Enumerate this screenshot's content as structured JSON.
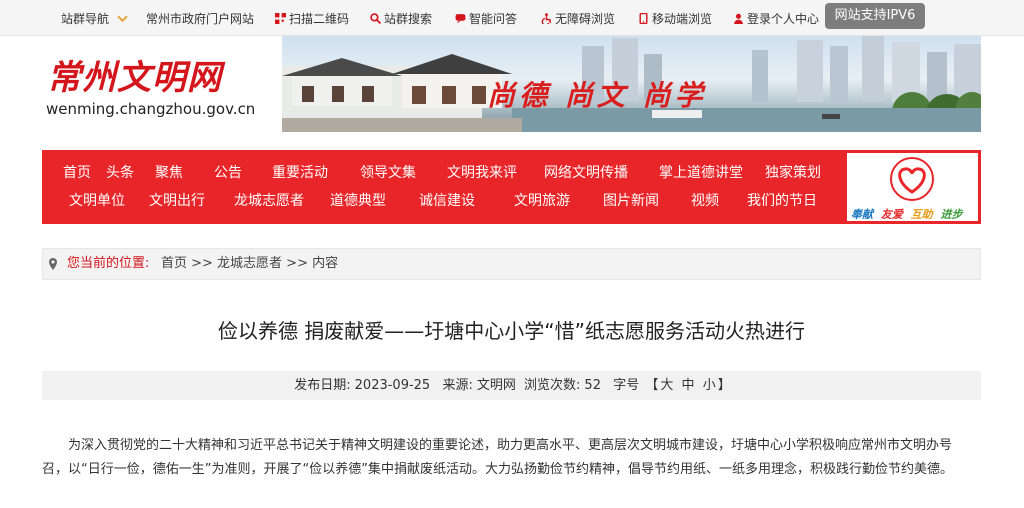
{
  "topbar": {
    "items": [
      {
        "label": "站群导航",
        "icon": "chevron-down-icon"
      },
      {
        "label": "常州市政府门户网站",
        "icon": ""
      },
      {
        "label": "扫描二维码",
        "icon": "qrcode-icon"
      },
      {
        "label": "站群搜索",
        "icon": "search-icon"
      },
      {
        "label": "智能问答",
        "icon": "chat-icon"
      },
      {
        "label": "无障碍浏览",
        "icon": "accessibility-icon"
      },
      {
        "label": "移动端浏览",
        "icon": "mobile-icon"
      },
      {
        "label": "登录个人中心",
        "icon": "user-icon"
      }
    ],
    "ipv6_label": "网站支持IPV6",
    "accent": "#d4161c"
  },
  "header": {
    "logo_cn": "常州文明网",
    "logo_en": "wenming.changzhou.gov.cn",
    "slogan": "尚德 尚文 尚学"
  },
  "nav": {
    "row1": [
      "首页",
      "头条",
      "聚焦",
      "公告",
      "重要活动",
      "领导文集",
      "文明我来评",
      "网络文明传播",
      "掌上道德讲堂",
      "独家策划"
    ],
    "row2": [
      "文明单位",
      "文明出行",
      "龙城志愿者",
      "道德典型",
      "诚信建设",
      "文明旅游",
      "图片新闻",
      "视频",
      "我们的节日"
    ],
    "badge_words": [
      "奉献",
      "友爱",
      "互助",
      "进步"
    ],
    "bg_color": "#e8262a"
  },
  "breadcrumb": {
    "label": "您当前的位置:",
    "path": "首页 >> 龙城志愿者 >> 内容"
  },
  "article": {
    "title": "俭以养德 捐废献爱——圩塘中心小学“惜”纸志愿服务活动火热进行",
    "date_label": "发布日期:",
    "date": "2023-09-25",
    "source_label": "来源:",
    "source": "文明网",
    "views_label": "浏览次数:",
    "views": "52",
    "font_label": "字号",
    "font_sizes": [
      "大",
      "中",
      "小"
    ],
    "paragraph": "为深入贯彻党的二十大精神和习近平总书记关于精神文明建设的重要论述，助力更高水平、更高层次文明城市建设，圩塘中心小学积极响应常州市文明办号召，以“日行一俭，德佑一生”为准则，开展了“俭以养德”集中捐献废纸活动。大力弘扬勤俭节约精神，倡导节约用纸、一纸多用理念，积极践行勤俭节约美德。"
  }
}
